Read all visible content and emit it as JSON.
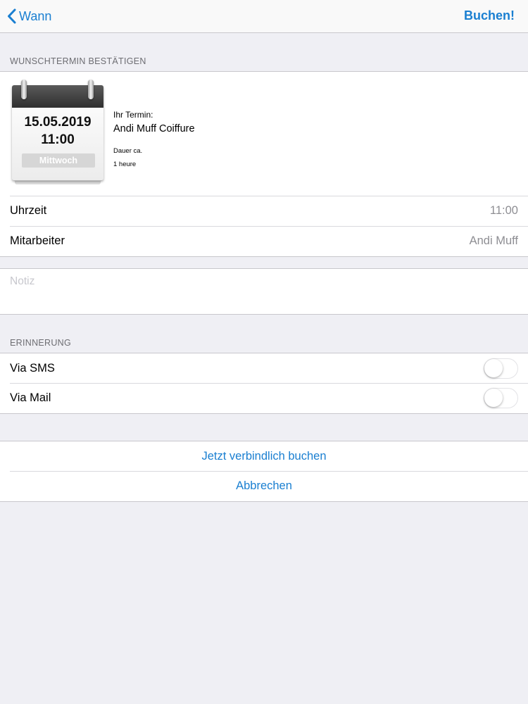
{
  "nav": {
    "back_label": "Wann",
    "action_label": "Buchen!"
  },
  "confirm": {
    "section_header": "WUNSCHTERMIN BESTÄTIGEN",
    "calendar": {
      "date": "15.05.2019",
      "time": "11:00",
      "weekday": "Mittwoch"
    },
    "appointment_label": "Ihr Termin:",
    "salon_name": "Andi Muff Coiffure",
    "duration_label": "Dauer ca.",
    "duration_value": "1 heure",
    "rows": [
      {
        "label": "Uhrzeit",
        "value": "11:00"
      },
      {
        "label": "Mitarbeiter",
        "value": "Andi Muff"
      }
    ]
  },
  "note": {
    "placeholder": "Notiz"
  },
  "reminder": {
    "section_header": "ERINNERUNG",
    "options": [
      {
        "label": "Via SMS",
        "enabled": false
      },
      {
        "label": "Via Mail",
        "enabled": false
      }
    ]
  },
  "actions": {
    "book_label": "Jetzt verbindlich buchen",
    "cancel_label": "Abbrechen"
  },
  "colors": {
    "accent": "#1a7fd1",
    "background": "#efeff4",
    "secondary_text": "#8e8e93"
  }
}
